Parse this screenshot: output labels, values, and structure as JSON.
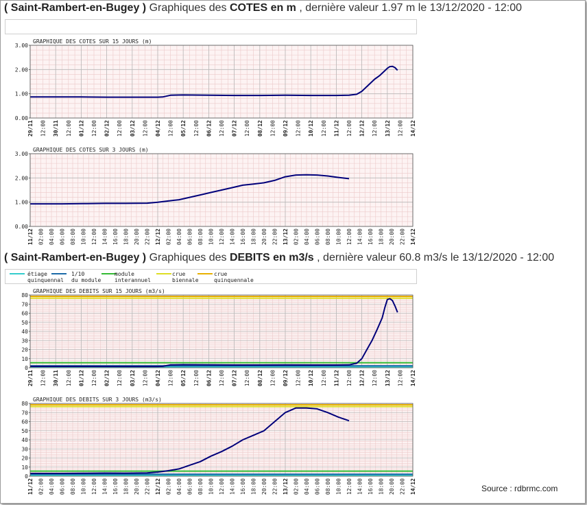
{
  "headings": {
    "cotes": {
      "station": "( Saint-Rambert-en-Bugey )",
      "pre": "Graphiques des",
      "bold": "COTES en m",
      "post": ", dernière valeur 1.97 m le 13/12/2020 - 12:00"
    },
    "debits": {
      "station": "( Saint-Rambert-en-Bugey )",
      "pre": "Graphiques des",
      "bold": "DEBITS en m3/s",
      "post": ", dernière valeur 60.8 m3/s le 13/12/2020 - 12:00"
    }
  },
  "legend": [
    {
      "l1": "étiage",
      "l2": "quinquennal",
      "color": "#33cccc"
    },
    {
      "l1": "1/10",
      "l2": "du module",
      "color": "#1a6aa8"
    },
    {
      "l1": "module",
      "l2": "interannuel",
      "color": "#33bb33"
    },
    {
      "l1": "crue",
      "l2": "biennale",
      "color": "#dddd22"
    },
    {
      "l1": "crue",
      "l2": "quinquennale",
      "color": "#e8b000"
    }
  ],
  "source": "Source : rdbrmc.com",
  "colors": {
    "plot_bg": "#fdf3f3",
    "grid_minor": "#ecc9c9",
    "grid_major": "#b8b8b8",
    "series": "#00007a"
  },
  "chart_data": [
    {
      "type": "line",
      "title": "GRAPHIQUE DES COTES SUR 15 JOURS (m)",
      "xlim": [
        0,
        15
      ],
      "ylim": [
        0,
        3
      ],
      "yticks": [
        0,
        1,
        2,
        3
      ],
      "ytick_labels": [
        "0.00",
        "1.00",
        "2.00",
        "3.00"
      ],
      "xtick_labels": [
        "29/11",
        "12:00",
        "30/11",
        "12:00",
        "01/12",
        "12:00",
        "02/12",
        "12:00",
        "03/12",
        "12:00",
        "04/12",
        "12:00",
        "05/12",
        "12:00",
        "06/12",
        "12:00",
        "07/12",
        "12:00",
        "08/12",
        "12:00",
        "09/12",
        "12:00",
        "10/12",
        "12:00",
        "11/12",
        "12:00",
        "12/12",
        "12:00",
        "13/12",
        "12:00",
        "14/12"
      ],
      "ygrid_step": 0.2,
      "thresholds": [],
      "x": [
        0,
        2,
        3,
        4,
        5,
        5.2,
        5.5,
        6,
        7,
        8,
        9,
        10,
        11,
        12,
        12.5,
        12.8,
        13,
        13.2,
        13.5,
        13.7,
        13.8,
        13.9,
        14.0,
        14.1,
        14.2,
        14.3,
        14.4
      ],
      "y": [
        0.87,
        0.87,
        0.86,
        0.86,
        0.86,
        0.87,
        0.94,
        0.95,
        0.94,
        0.93,
        0.93,
        0.94,
        0.93,
        0.93,
        0.94,
        0.98,
        1.1,
        1.3,
        1.6,
        1.75,
        1.85,
        1.95,
        2.05,
        2.12,
        2.13,
        2.08,
        1.97
      ]
    },
    {
      "type": "line",
      "title": "GRAPHIQUE DES COTES SUR 3 JOURS (m)",
      "xlim": [
        0,
        72
      ],
      "ylim": [
        0,
        3
      ],
      "yticks": [
        0,
        1,
        2,
        3
      ],
      "ytick_labels": [
        "0.00",
        "1.00",
        "2.00",
        "3.00"
      ],
      "xtick_labels": [
        "11/12",
        "02:00",
        "04:00",
        "06:00",
        "08:00",
        "10:00",
        "12:00",
        "14:00",
        "16:00",
        "18:00",
        "20:00",
        "22:00",
        "12/12",
        "02:00",
        "04:00",
        "06:00",
        "08:00",
        "10:00",
        "12:00",
        "14:00",
        "16:00",
        "18:00",
        "20:00",
        "22:00",
        "13/12",
        "02:00",
        "04:00",
        "06:00",
        "08:00",
        "10:00",
        "12:00",
        "14:00",
        "16:00",
        "18:00",
        "20:00",
        "22:00",
        "14/12"
      ],
      "ygrid_step": 0.2,
      "thresholds": [],
      "x": [
        0,
        6,
        10,
        14,
        18,
        22,
        24,
        26,
        28,
        30,
        32,
        34,
        36,
        38,
        40,
        42,
        44,
        46,
        48,
        50,
        52,
        54,
        56,
        58,
        60
      ],
      "y": [
        0.93,
        0.93,
        0.94,
        0.95,
        0.95,
        0.96,
        1.0,
        1.05,
        1.1,
        1.2,
        1.3,
        1.4,
        1.5,
        1.6,
        1.7,
        1.75,
        1.8,
        1.9,
        2.05,
        2.12,
        2.13,
        2.12,
        2.08,
        2.02,
        1.97
      ]
    },
    {
      "type": "line",
      "title": "GRAPHIQUE DES DEBITS SUR 15 JOURS (m3/s)",
      "xlim": [
        0,
        15
      ],
      "ylim": [
        0,
        80
      ],
      "yticks": [
        0,
        10,
        20,
        30,
        40,
        50,
        60,
        70,
        80
      ],
      "ytick_labels": [
        "0",
        "10",
        "20",
        "30",
        "40",
        "50",
        "60",
        "70",
        "80"
      ],
      "xtick_labels": [
        "29/11",
        "12:00",
        "30/11",
        "12:00",
        "01/12",
        "12:00",
        "02/12",
        "12:00",
        "03/12",
        "12:00",
        "04/12",
        "12:00",
        "05/12",
        "12:00",
        "06/12",
        "12:00",
        "07/12",
        "12:00",
        "08/12",
        "12:00",
        "09/12",
        "12:00",
        "10/12",
        "12:00",
        "11/12",
        "12:00",
        "12/12",
        "12:00",
        "13/12",
        "12:00",
        "14/12"
      ],
      "ygrid_step": 2,
      "thresholds": [
        {
          "name": "étiage quinquennal",
          "value": 1.0,
          "color": "#33cccc"
        },
        {
          "name": "1/10 du module",
          "value": 2.2,
          "color": "#1a6aa8"
        },
        {
          "name": "module interannuel",
          "value": 5.6,
          "color": "#33bb33"
        },
        {
          "name": "crue biennale",
          "value": 76.5,
          "color": "#dddd22"
        },
        {
          "name": "crue quinquennale",
          "value": 78.5,
          "color": "#e8b000"
        }
      ],
      "x": [
        0,
        2,
        4,
        5,
        5.2,
        5.5,
        6,
        7,
        8,
        9,
        10,
        11,
        12,
        12.5,
        12.8,
        13,
        13.2,
        13.4,
        13.6,
        13.8,
        13.9,
        14.0,
        14.1,
        14.2,
        14.3,
        14.4
      ],
      "y": [
        1.5,
        1.5,
        1.4,
        1.4,
        1.6,
        3.2,
        3.4,
        3.2,
        3.0,
        3.0,
        3.1,
        3.0,
        3.0,
        3.2,
        5,
        10,
        20,
        30,
        42,
        55,
        66,
        75,
        76,
        74,
        68,
        61
      ]
    },
    {
      "type": "line",
      "title": "GRAPHIQUE DES DEBITS SUR 3 JOURS (m3/s)",
      "xlim": [
        0,
        72
      ],
      "ylim": [
        0,
        80
      ],
      "yticks": [
        0,
        10,
        20,
        30,
        40,
        50,
        60,
        70,
        80
      ],
      "ytick_labels": [
        "0",
        "10",
        "20",
        "30",
        "40",
        "50",
        "60",
        "70",
        "80"
      ],
      "xtick_labels": [
        "11/12",
        "02:00",
        "04:00",
        "06:00",
        "08:00",
        "10:00",
        "12:00",
        "14:00",
        "16:00",
        "18:00",
        "20:00",
        "22:00",
        "12/12",
        "02:00",
        "04:00",
        "06:00",
        "08:00",
        "10:00",
        "12:00",
        "14:00",
        "16:00",
        "18:00",
        "20:00",
        "22:00",
        "13/12",
        "02:00",
        "04:00",
        "06:00",
        "08:00",
        "10:00",
        "12:00",
        "14:00",
        "16:00",
        "18:00",
        "20:00",
        "22:00",
        "14/12"
      ],
      "ygrid_step": 2,
      "thresholds": [
        {
          "name": "étiage quinquennal",
          "value": 1.0,
          "color": "#33cccc"
        },
        {
          "name": "1/10 du module",
          "value": 2.2,
          "color": "#1a6aa8"
        },
        {
          "name": "module interannuel",
          "value": 5.6,
          "color": "#33bb33"
        },
        {
          "name": "crue biennale",
          "value": 76.5,
          "color": "#dddd22"
        },
        {
          "name": "crue quinquennale",
          "value": 78.5,
          "color": "#e8b000"
        }
      ],
      "x": [
        0,
        6,
        10,
        14,
        18,
        22,
        24,
        26,
        28,
        30,
        32,
        34,
        36,
        38,
        40,
        42,
        44,
        46,
        48,
        50,
        52,
        54,
        56,
        58,
        60
      ],
      "y": [
        3.0,
        3.0,
        3.2,
        3.4,
        3.3,
        3.6,
        4.5,
        6,
        8,
        12,
        16,
        22,
        27,
        33,
        40,
        45,
        50,
        60,
        70,
        75,
        75,
        74,
        70,
        65,
        61
      ]
    }
  ]
}
